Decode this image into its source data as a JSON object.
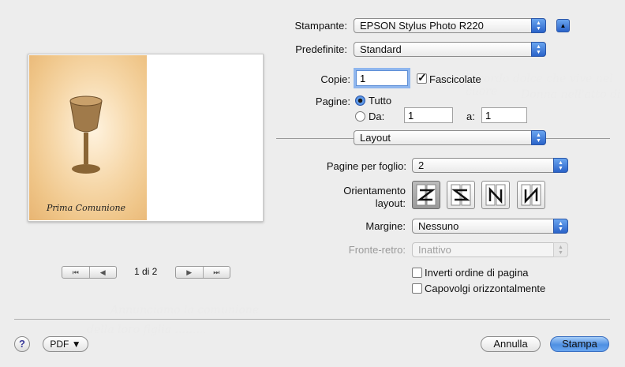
{
  "printer": {
    "label": "Stampante:",
    "value": "EPSON Stylus Photo R220"
  },
  "presets": {
    "label": "Predefinite:",
    "value": "Standard"
  },
  "copies": {
    "label": "Copie:",
    "value": "1",
    "collated_label": "Fascicolate",
    "collated": true
  },
  "pages": {
    "label": "Pagine:",
    "all_label": "Tutto",
    "all_selected": true,
    "from_label": "Da:",
    "from_value": "1",
    "to_label": "a:",
    "to_value": "1"
  },
  "panel_select": {
    "value": "Layout"
  },
  "layout": {
    "pages_per_sheet_label": "Pagine per foglio:",
    "pages_per_sheet_value": "2",
    "orientation_label_line1": "Orientamento",
    "orientation_label_line2": "layout:",
    "orientation_icons": [
      "layout-z-icon",
      "layout-s-icon",
      "layout-n-icon",
      "layout-n-reverse-icon"
    ],
    "orientation_selected": 0,
    "border_label": "Margine:",
    "border_value": "Nessuno",
    "two_sided_label": "Fronte-retro:",
    "two_sided_value": "Inattivo",
    "reverse_order_label": "Inverti ordine di pagina",
    "reverse_order": false,
    "flip_label": "Capovolgi orizzontalmente",
    "flip": false
  },
  "preview": {
    "page_indicator": "1 di 2",
    "card_caption": "Prima Comunione"
  },
  "footer": {
    "help": "?",
    "pdf_label": "PDF ▼",
    "cancel_label": "Annulla",
    "print_label": "Stampa"
  },
  "colors": {
    "accent": "#3b74d4",
    "card": "#f2cf9a"
  }
}
